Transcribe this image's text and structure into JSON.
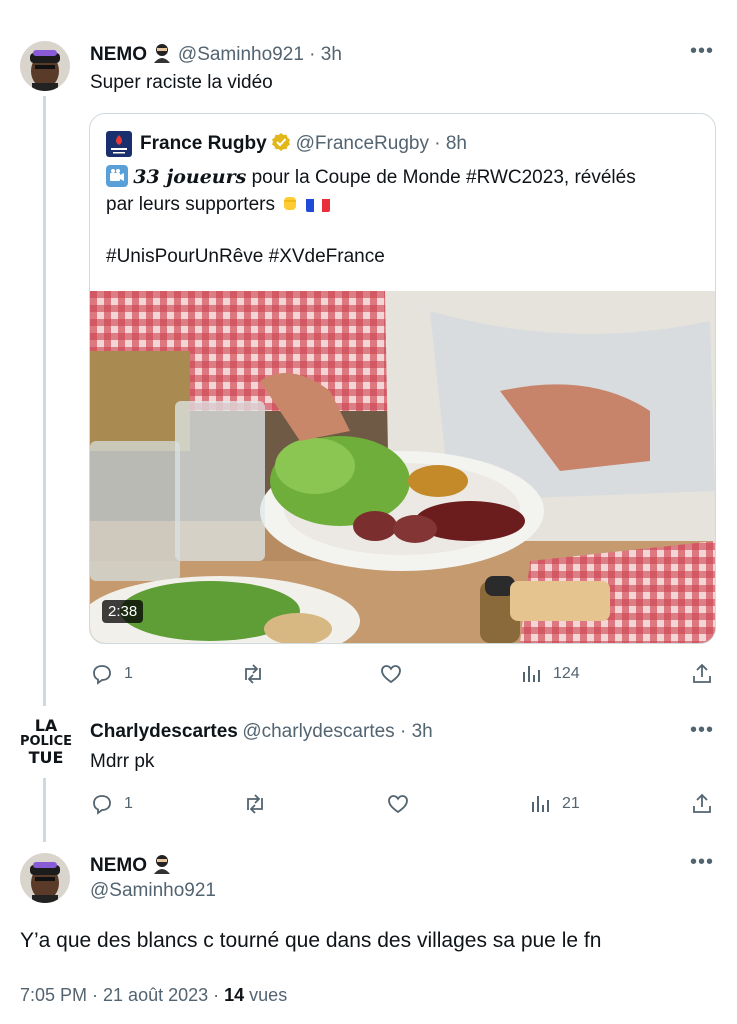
{
  "tweet1": {
    "name": "NEMO",
    "handle": "@Saminho921",
    "time": "3h",
    "text": "Super raciste la vidéo",
    "replies": "1",
    "views": "124"
  },
  "quote": {
    "name": "France Rugby",
    "handle": "@FranceRugby",
    "time": "8h",
    "bold_text": "33 joueurs",
    "text_rest": " pour la Coupe de Monde #RWC2023, révélés",
    "line2": "par leurs supporters",
    "hashtags": "#UnisPourUnRêve #XVdeFrance",
    "video_duration": "2:38"
  },
  "tweet2": {
    "name": "Charlydescartes",
    "handle": "@charlydescartes",
    "time": "3h",
    "text": "Mdrr pk",
    "replies": "1",
    "views": "21",
    "avatar_text": [
      "LA",
      "POLICE",
      "TUE"
    ]
  },
  "tweet3": {
    "name": "NEMO",
    "handle": "@Saminho921",
    "text": "Y’a que des blancs c tourné que dans des villages sa pue le fn",
    "timestamp": "7:05 PM · 21 août 2023 · ",
    "views_count": "14",
    "views_label": " vues"
  },
  "colors": {
    "accent": "#1d9bf0",
    "muted": "#536471",
    "verified": "#e2b719",
    "line": "#cfd9de"
  }
}
